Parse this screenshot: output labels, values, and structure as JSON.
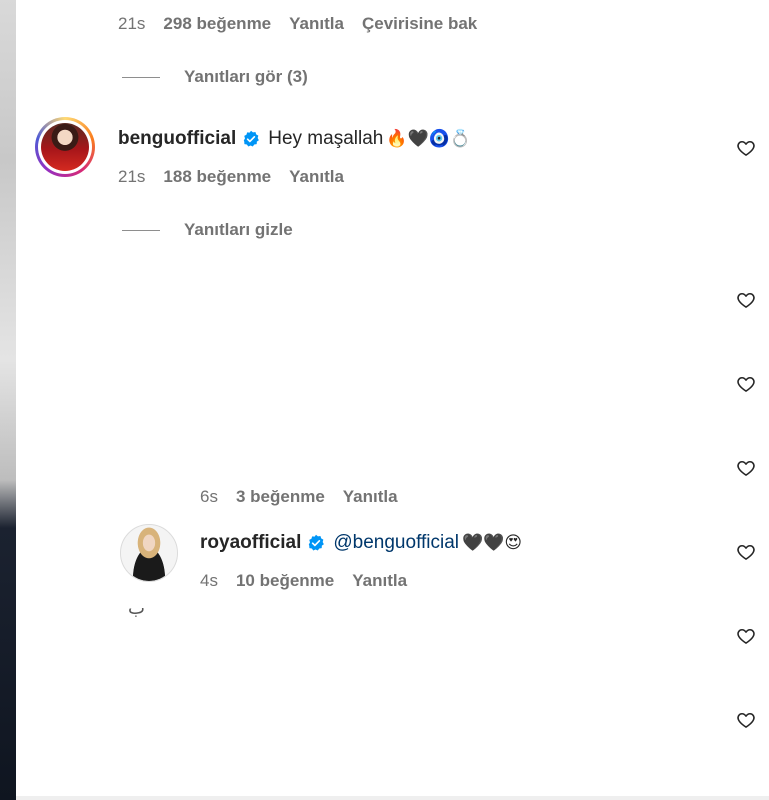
{
  "top_comment_meta": {
    "time": "21s",
    "likes": "298 beğenme",
    "reply": "Yanıtla",
    "translate": "Çevirisine bak"
  },
  "show_replies": {
    "label": "Yanıtları gör (3)"
  },
  "comment_bengu": {
    "username": "benguofficial",
    "text": "Hey maşallah",
    "emojis": "🔥🖤🧿💍",
    "time": "21s",
    "likes": "188 beğenme",
    "reply": "Yanıtla"
  },
  "hide_replies": {
    "label": "Yanıtları gizle"
  },
  "reply_meta_partial": {
    "time": "6s",
    "likes": "3 beğenme",
    "reply": "Yanıtla"
  },
  "comment_roya": {
    "username": "royaofficial",
    "mention": "@benguofficial",
    "emojis": "🖤🖤😍",
    "time": "4s",
    "likes": "10 beğenme",
    "reply": "Yanıtla"
  },
  "icons": {
    "verified": "verified-badge-icon",
    "like": "heart-outline-icon"
  },
  "colors": {
    "verified_blue": "#0095f6",
    "meta_gray": "#737373",
    "mention_blue": "#00376b"
  }
}
